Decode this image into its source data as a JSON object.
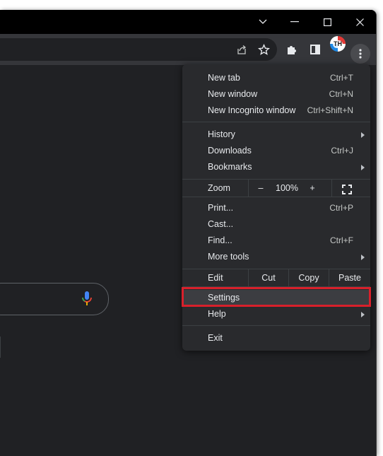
{
  "window_controls": {
    "dropdown_icon": "chevron-down-icon",
    "minimize_icon": "minimize-icon",
    "maximize_icon": "maximize-icon",
    "close_icon": "close-icon"
  },
  "toolbar": {
    "icons": [
      "share-icon",
      "bookmark-star-icon",
      "extensions-icon",
      "side-panel-icon",
      "profile-avatar",
      "more-menu-icon"
    ],
    "avatar_initials": "TH"
  },
  "menu": {
    "section1": [
      {
        "label": "New tab",
        "shortcut": "Ctrl+T"
      },
      {
        "label": "New window",
        "shortcut": "Ctrl+N"
      },
      {
        "label": "New Incognito window",
        "shortcut": "Ctrl+Shift+N"
      }
    ],
    "section2": [
      {
        "label": "History",
        "shortcut": ""
      },
      {
        "label": "Downloads",
        "shortcut": "Ctrl+J"
      },
      {
        "label": "Bookmarks",
        "shortcut": ""
      }
    ],
    "zoom": {
      "label": "Zoom",
      "minus": "–",
      "value": "100%",
      "plus": "+"
    },
    "section3": [
      {
        "label": "Print...",
        "shortcut": "Ctrl+P"
      },
      {
        "label": "Cast...",
        "shortcut": ""
      },
      {
        "label": "Find...",
        "shortcut": "Ctrl+F"
      },
      {
        "label": "More tools",
        "shortcut": ""
      }
    ],
    "edit": {
      "label": "Edit",
      "cut": "Cut",
      "copy": "Copy",
      "paste": "Paste"
    },
    "section4": [
      {
        "label": "Settings",
        "shortcut": ""
      },
      {
        "label": "Help",
        "shortcut": ""
      }
    ],
    "exit": {
      "label": "Exit"
    }
  },
  "colors": {
    "highlight_border": "#d8202b",
    "menu_bg": "#292a2d",
    "window_bg": "#202124"
  }
}
